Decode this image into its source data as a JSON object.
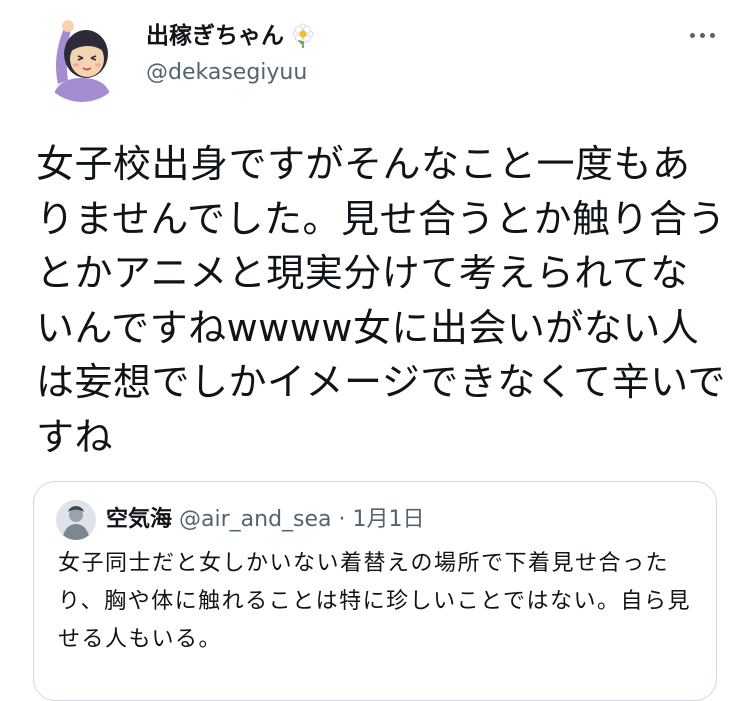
{
  "author": {
    "display_name": "出稼ぎちゃん",
    "username": "@dekasegiyuu",
    "avatar_icon": "user-avatar-icon",
    "name_emoji_icon": "flower-icon"
  },
  "more_icon": "more-icon",
  "tweet": {
    "text": "女子校出身ですがそんなこと一度もありませんでした。見せ合うとか触り合うとかアニメと現実分けて考えられてないんですねwwww女に出会いがない人は妄想でしかイメージできなくて辛いですね"
  },
  "quote": {
    "display_name": "空気海",
    "handle": "@air_and_sea",
    "separator": "·",
    "date": "1月1日",
    "text": "女子同士だと女しかいない着替えの場所で下着見せ合ったり、胸や体に触れることは特に珍しいことではない。自ら見せる人もいる。"
  },
  "colors": {
    "text_primary": "#0f1419",
    "text_secondary": "#536471",
    "border": "#cfd9de"
  }
}
